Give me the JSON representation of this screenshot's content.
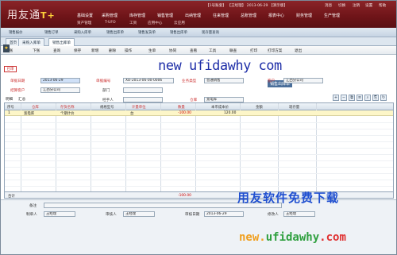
{
  "banner": {
    "logo_text": "用友通",
    "logo_mark": "T+",
    "top_info": "【1号账套】  【王经理】  2013-06-29  【演示版】",
    "top_links": [
      "消息",
      "切换",
      "注销",
      "设置",
      "帮助"
    ],
    "menu": [
      "基础设置",
      "采购管理",
      "库存管理",
      "销售管理",
      "出纳管理",
      "往来管理",
      "总账管理",
      "报表中心",
      "财务管理",
      "生产管理"
    ],
    "submenu": [
      "资产管理",
      "T-UFO",
      "工资",
      "应用中心",
      "云应用"
    ]
  },
  "shortcuts": [
    "销售报价",
    "销售订单",
    "采购入库单",
    "销售出库单",
    "销售发货单",
    "销售出库单",
    "现存量查询"
  ],
  "tabs": [
    {
      "label": "首页",
      "active": false
    },
    {
      "label": "采购入库单",
      "active": false
    },
    {
      "label": "销售出库单",
      "active": true
    }
  ],
  "toolbar": [
    "上张",
    "下张",
    "查询",
    "保存",
    "新增",
    "删除",
    "操作",
    "生单",
    "协同",
    "查看",
    "工具",
    "联查",
    "打印",
    "打印方案",
    "退出"
  ],
  "document": {
    "status_stamp": "已审",
    "watermark_url": "new ufidawhy com",
    "title_badge": "销售出库单",
    "fields": {
      "date_label": "单据日期",
      "date_value": "2013-06-29",
      "code_label": "单据编号",
      "code_value": "XO-2013-06-00-0006",
      "type_label": "业务类型",
      "type_value": "普通销售",
      "customer_label": "客户",
      "customer_value": "江西分公司",
      "settle_label": "结算客户",
      "settle_value": "江西分公司",
      "dept_label": "部门",
      "dept_value": "",
      "handler_label": "经手人",
      "handler_value": "",
      "warehouse_label": "仓库",
      "warehouse_value": "宽电库",
      "note_label": "明细",
      "note_value": "汇总"
    }
  },
  "grid": {
    "headers": [
      "序号",
      "仓库",
      "存货名称",
      "规格型号",
      "计量单位",
      "数量",
      "本币成本价",
      "金额",
      "现存量"
    ],
    "rows": [
      {
        "no": "1",
        "warehouse": "宽电库",
        "name": "个期计价",
        "spec": "",
        "unit": "台",
        "qty": "-100.00",
        "price": "120.00",
        "amount": "",
        "stock": ""
      }
    ],
    "total_label": "合计",
    "total_qty": "-100.00"
  },
  "footer": {
    "note_label": "备注",
    "maker_label": "制单人",
    "maker_value": "王经理",
    "auditor_label": "审核人",
    "auditor_value": "王经理",
    "audit_date_label": "审核日期",
    "audit_date_value": "2013-06-29",
    "modifier_label": "修改人",
    "modifier_value": "王经理"
  },
  "watermarks": {
    "cn": "用友软件免费下载",
    "url_a": "new.",
    "url_b": "ufidawhy",
    "url_c": ".com"
  }
}
